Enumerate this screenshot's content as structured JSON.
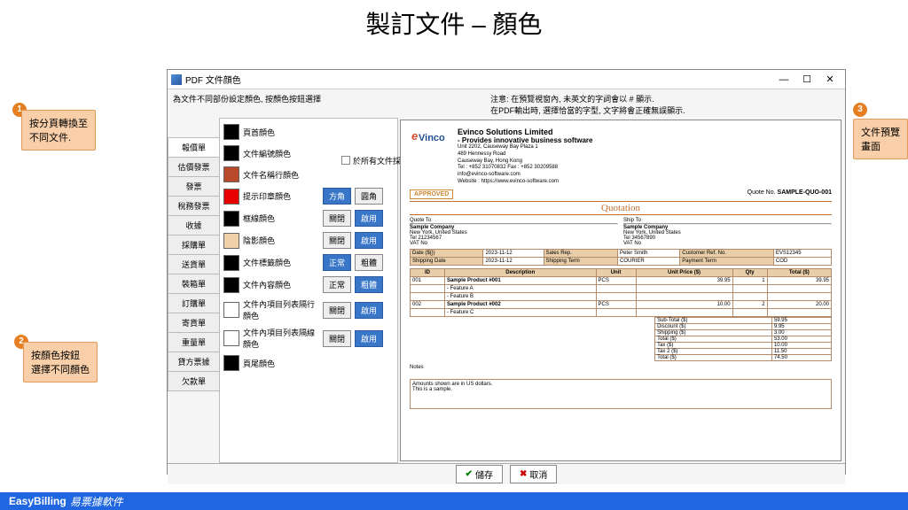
{
  "page_title": "製訂文件 – 顏色",
  "window_title": "PDF 文件顔色",
  "instructions_left": "為文件不同部份設定顏色, 按顏色按鈕選擇",
  "instructions_right1": "注意: 在預覽視窗內, 未英文的字詞會以 # 顯示.",
  "instructions_right2": "在PDF輸出時, 選擇恰當的字型, 文字將會正確無誤顯示.",
  "checkbox_label": "於所有文件採用同一文件外觀",
  "tabs": [
    "報價單",
    "估價發票",
    "發票",
    "稅務發票",
    "收據",
    "採購單",
    "送貨單",
    "裝箱單",
    "訂購單",
    "寄貨單",
    "重量單",
    "貸方票據",
    "欠款單"
  ],
  "color_rows": [
    {
      "label": "頁首顔色",
      "swatch": "#000000",
      "btn1": "",
      "btn2": ""
    },
    {
      "label": "文件編號顔色",
      "swatch": "#000000",
      "btn1": "",
      "btn2": ""
    },
    {
      "label": "文件名稱行顔色",
      "swatch": "#b84a2b",
      "btn1": "",
      "btn2": ""
    },
    {
      "label": "提示印章顔色",
      "swatch": "#e60000",
      "btn1": "方角",
      "btn2": "圓角",
      "btn1_active": true
    },
    {
      "label": "框線顔色",
      "swatch": "#000000",
      "btn1": "關閉",
      "btn2": "啟用",
      "btn2_active": true
    },
    {
      "label": "陰影顔色",
      "swatch": "#f0d0a8",
      "btn1": "關閉",
      "btn2": "啟用",
      "btn2_active": true
    },
    {
      "label": "文件標籤顔色",
      "swatch": "#000000",
      "btn1": "正常",
      "btn2": "粗體",
      "btn1_active": true
    },
    {
      "label": "文件內容顔色",
      "swatch": "#000000",
      "btn1": "正常",
      "btn2": "粗體",
      "btn2_active": true
    },
    {
      "label": "文件內項目列表隔行顔色",
      "swatch": "#ffffff",
      "btn1": "關閉",
      "btn2": "啟用",
      "btn2_active": true
    },
    {
      "label": "文件內項目列表隔線顔色",
      "swatch": "#ffffff",
      "btn1": "關閉",
      "btn2": "啟用",
      "btn2_active": true
    },
    {
      "label": "頁尾顔色",
      "swatch": "#000000",
      "btn1": "",
      "btn2": ""
    }
  ],
  "save_label": "儲存",
  "cancel_label": "取消",
  "callout1": "按分頁轉換至\n不同文件.",
  "callout2": "按顏色按鈕\n選擇不同顏色",
  "callout3": "文件預覽畫面",
  "bubble1": "1",
  "bubble2": "2",
  "bubble3": "3",
  "footer_brand": "EasyBilling",
  "footer_sub": "易票據軟件",
  "preview": {
    "company_name": "Evinco Solutions Limited",
    "company_tag": "- Provides innovative business software",
    "addr1": "Unit 2202, Causeway Bay Plaza 1",
    "addr2": "489 Hennessy Road",
    "addr3": "Causeway Bay, Hong Kong",
    "tel": "Tel : +852 31070832     Fax : +852 30209588",
    "email": "info@evinco-software.com",
    "web": "Website : https://www.evinco-software.com",
    "approved": "APPROVED",
    "quote_no_lbl": "Quote No.",
    "quote_no": "SAMPLE-QUO-001",
    "doc_title": "Quotation",
    "quote_to_lbl": "Quote To",
    "ship_to_lbl": "Ship To",
    "cust_name": "Sample Company",
    "cust_addr": "New York, United States",
    "cust_tel": "Tel 21234567",
    "cust_vat": "VAT No",
    "ship_tel": "Tel 34567890",
    "meta_date_lbl": "Date (${})",
    "meta_date": "2023-11-12",
    "meta_sales_lbl": "Sales Rep.",
    "meta_sales": "Peter Smith",
    "meta_ref_lbl": "Customer Ref. No.",
    "meta_ref": "EVS12345",
    "meta_ship_lbl": "Shipping Date",
    "meta_ship": "2023-11-12",
    "meta_term_lbl": "Shipping Term",
    "meta_term": "COURIER",
    "meta_pay_lbl": "Payment Term",
    "meta_pay": "COD",
    "col_id": "ID",
    "col_desc": "Description",
    "col_unit": "Unit",
    "col_price": "Unit Price ($)",
    "col_qty": "Qty",
    "col_total": "Total ($)",
    "r1_id": "001",
    "r1_desc": "Sample Product #001",
    "r1_unit": "PCS",
    "r1_price": "39.95",
    "r1_qty": "1",
    "r1_total": "39.95",
    "r1a": "- Feature A",
    "r1b": "- Feature B",
    "r2_id": "002",
    "r2_desc": "Sample Product #002",
    "r2_unit": "PCS",
    "r2_price": "10.00",
    "r2_qty": "2",
    "r2_total": "20.00",
    "r2a": "- Feature C",
    "t1l": "Sub-Total ($)",
    "t1": "59.95",
    "t2l": "Discount ($)",
    "t2": "9.95",
    "t3l": "Shipping ($)",
    "t3": "3.00",
    "t4l": "Total ($)",
    "t4": "53.00",
    "t5l": "Tax ($)",
    "t5": "10.00",
    "t6l": "Tax 2 ($)",
    "t6": "11.50",
    "t7l": "Total ($)",
    "t7": "74.50",
    "notes_lbl": "Notes",
    "notes1": "Amounts shown are in US dollars.",
    "notes2": "This is a sample."
  }
}
